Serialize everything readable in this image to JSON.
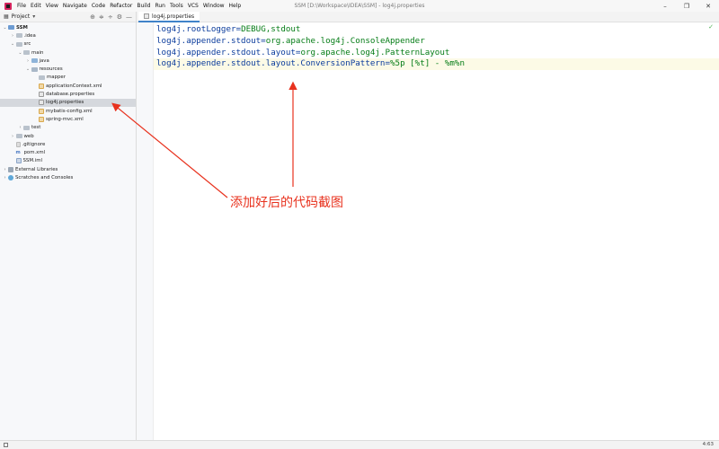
{
  "menu": [
    "File",
    "Edit",
    "View",
    "Navigate",
    "Code",
    "Refactor",
    "Build",
    "Run",
    "Tools",
    "VCS",
    "Window",
    "Help"
  ],
  "window_title": "SSM [D:\\Workspace\\IDEA\\SSM] - log4j.properties",
  "window_controls": {
    "minimize": "–",
    "maximize": "❐",
    "close": "✕"
  },
  "project_panel": {
    "title": "Project",
    "dropdown": "▾",
    "tools": [
      "⊕",
      "≑",
      "÷",
      "⚙",
      "—"
    ]
  },
  "tree": [
    {
      "label": "SSM",
      "depth": 0,
      "expanded": true,
      "icon": "folder-blue",
      "bold": true
    },
    {
      "label": ".idea",
      "depth": 1,
      "expanded": false,
      "icon": "folder"
    },
    {
      "label": "src",
      "depth": 1,
      "expanded": true,
      "icon": "folder"
    },
    {
      "label": "main",
      "depth": 2,
      "expanded": true,
      "icon": "folder"
    },
    {
      "label": "java",
      "depth": 3,
      "expanded": false,
      "icon": "folder-src"
    },
    {
      "label": "resources",
      "depth": 3,
      "expanded": true,
      "icon": "folder-res"
    },
    {
      "label": "mapper",
      "depth": 4,
      "icon": "folder"
    },
    {
      "label": "applicationContext.xml",
      "depth": 4,
      "icon": "file-xml"
    },
    {
      "label": "database.properties",
      "depth": 4,
      "icon": "file-prop"
    },
    {
      "label": "log4j.properties",
      "depth": 4,
      "icon": "file-prop",
      "selected": true
    },
    {
      "label": "mybatis-config.xml",
      "depth": 4,
      "icon": "file-xml"
    },
    {
      "label": "spring-mvc.xml",
      "depth": 4,
      "icon": "file-xml"
    },
    {
      "label": "test",
      "depth": 2,
      "expanded": false,
      "icon": "folder"
    },
    {
      "label": "web",
      "depth": 1,
      "expanded": false,
      "icon": "folder"
    },
    {
      "label": ".gitignore",
      "depth": 1,
      "icon": "file-git"
    },
    {
      "label": "pom.xml",
      "depth": 1,
      "icon": "file-pom"
    },
    {
      "label": "SSM.iml",
      "depth": 1,
      "icon": "file-iml"
    },
    {
      "label": "External Libraries",
      "depth": 0,
      "expanded": false,
      "icon": "lib"
    },
    {
      "label": "Scratches and Consoles",
      "depth": 0,
      "expanded": false,
      "icon": "scratch"
    }
  ],
  "editor": {
    "tab_label": "log4j.properties",
    "lines": [
      {
        "key": "log4j.rootLogger",
        "eq": "=",
        "value": "DEBUG,stdout"
      },
      {
        "key": "log4j.appender.stdout",
        "eq": "=",
        "value": "org.apache.log4j.ConsoleAppender"
      },
      {
        "key": "log4j.appender.stdout.layout",
        "eq": "=",
        "value": "org.apache.log4j.PatternLayout"
      },
      {
        "key": "log4j.appender.stdout.layout.ConversionPattern",
        "eq": "=",
        "value": "%5p [%t] - %m%n"
      }
    ],
    "check_mark": "✓"
  },
  "annotation": {
    "text": "添加好后的代码截图",
    "color": "#e8321e"
  },
  "status_bar": {
    "cursor": "4:63"
  },
  "colors": {
    "key": "#0b3c9c",
    "value": "#067d17",
    "selection": "#d5d8dd",
    "current_line": "#fcfae6"
  }
}
